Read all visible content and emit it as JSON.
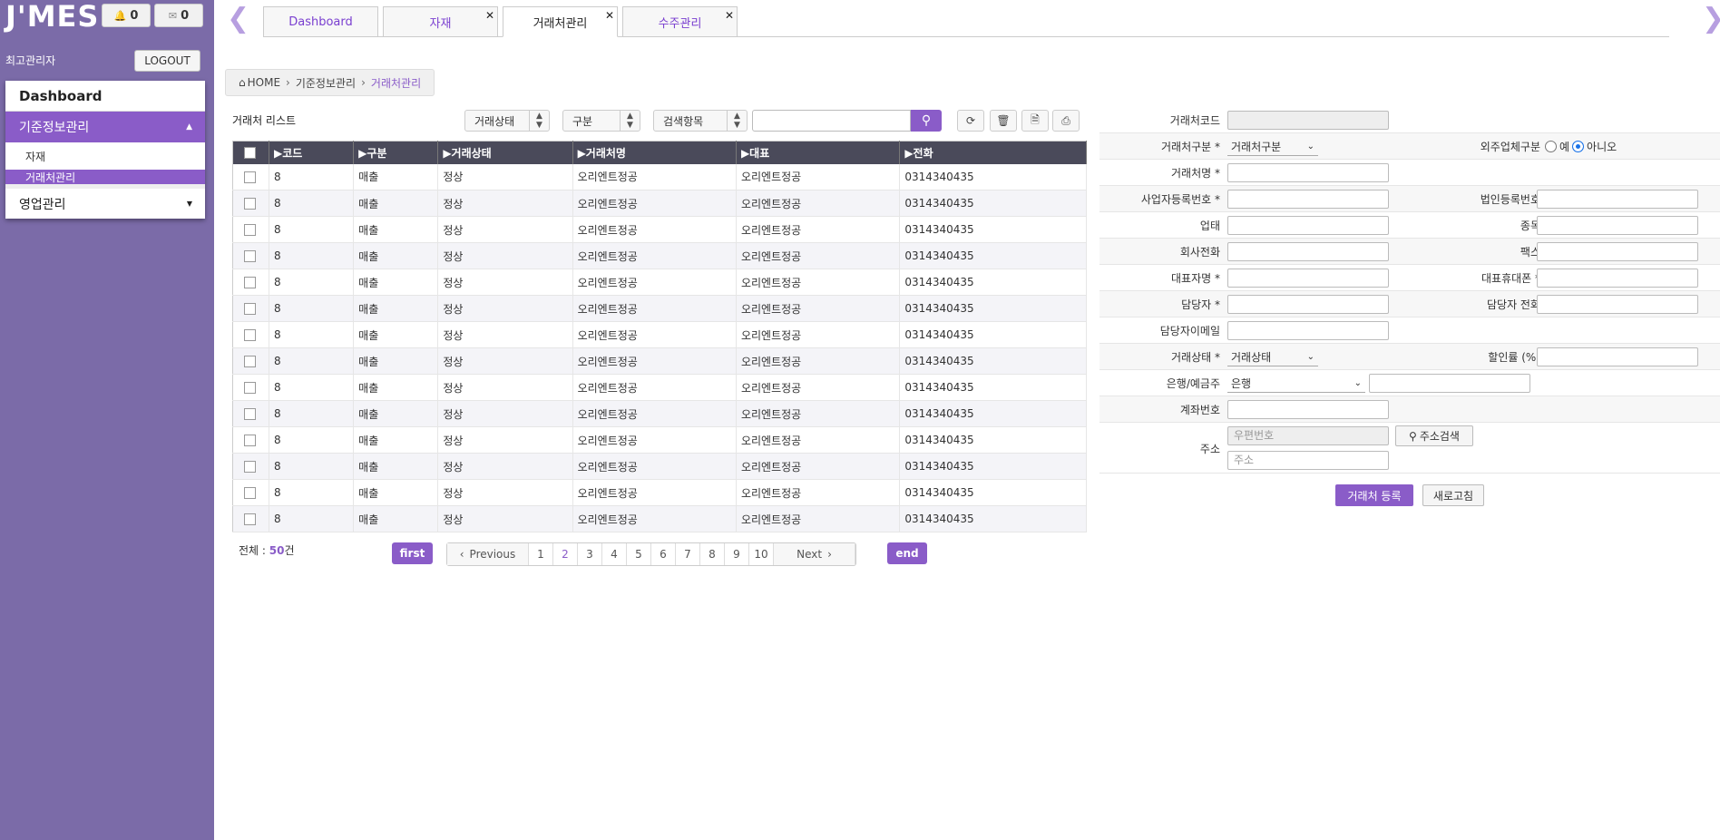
{
  "app": {
    "logo": "J'MES",
    "notifications": "0",
    "messages": "0",
    "user": "최고관리자",
    "logout_label": "LOGOUT"
  },
  "sidebar": {
    "dashboard": "Dashboard",
    "group1": {
      "label": "기준정보관리",
      "items": [
        "자재",
        "거래처관리"
      ]
    },
    "group2": {
      "label": "영업관리"
    }
  },
  "tabs": [
    {
      "label": "Dashboard",
      "closable": false
    },
    {
      "label": "자재",
      "closable": true
    },
    {
      "label": "거래처관리",
      "closable": true,
      "active": true
    },
    {
      "label": "수주관리",
      "closable": true
    }
  ],
  "breadcrumb": {
    "home": "HOME",
    "level1": "기준정보관리",
    "current": "거래처관리"
  },
  "list": {
    "title": "거래처 리스트",
    "filters": {
      "status": "거래상태",
      "type": "구분",
      "search_field": "검색항목"
    },
    "search_value": "",
    "columns": [
      "▶코드",
      "▶구분",
      "▶거래상태",
      "▶거래처명",
      "▶대표",
      "▶전화"
    ],
    "rows": [
      [
        "8",
        "매출",
        "정상",
        "오리엔트정공",
        "오리엔트정공",
        "0314340435"
      ],
      [
        "8",
        "매출",
        "정상",
        "오리엔트정공",
        "오리엔트정공",
        "0314340435"
      ],
      [
        "8",
        "매출",
        "정상",
        "오리엔트정공",
        "오리엔트정공",
        "0314340435"
      ],
      [
        "8",
        "매출",
        "정상",
        "오리엔트정공",
        "오리엔트정공",
        "0314340435"
      ],
      [
        "8",
        "매출",
        "정상",
        "오리엔트정공",
        "오리엔트정공",
        "0314340435"
      ],
      [
        "8",
        "매출",
        "정상",
        "오리엔트정공",
        "오리엔트정공",
        "0314340435"
      ],
      [
        "8",
        "매출",
        "정상",
        "오리엔트정공",
        "오리엔트정공",
        "0314340435"
      ],
      [
        "8",
        "매출",
        "정상",
        "오리엔트정공",
        "오리엔트정공",
        "0314340435"
      ],
      [
        "8",
        "매출",
        "정상",
        "오리엔트정공",
        "오리엔트정공",
        "0314340435"
      ],
      [
        "8",
        "매출",
        "정상",
        "오리엔트정공",
        "오리엔트정공",
        "0314340435"
      ],
      [
        "8",
        "매출",
        "정상",
        "오리엔트정공",
        "오리엔트정공",
        "0314340435"
      ],
      [
        "8",
        "매출",
        "정상",
        "오리엔트정공",
        "오리엔트정공",
        "0314340435"
      ],
      [
        "8",
        "매출",
        "정상",
        "오리엔트정공",
        "오리엔트정공",
        "0314340435"
      ],
      [
        "8",
        "매출",
        "정상",
        "오리엔트정공",
        "오리엔트정공",
        "0314340435"
      ]
    ],
    "total_label": "전체 : ",
    "total_count": "50",
    "total_unit": "건"
  },
  "pagination": {
    "first": "first",
    "previous": "Previous",
    "next": "Next",
    "end": "end",
    "pages": [
      "1",
      "2",
      "3",
      "4",
      "5",
      "6",
      "7",
      "8",
      "9",
      "10"
    ],
    "current": "2"
  },
  "form": {
    "code": "거래처코드",
    "type": "거래처구분 *",
    "type_value": "거래처구분",
    "outsource": "외주업체구분",
    "outsource_yes": "예",
    "outsource_no": "아니오",
    "name": "거래처명 *",
    "biz_no": "사업자등록번호 *",
    "corp_no": "법인등록번호",
    "biz_type": "업태",
    "biz_item": "종목",
    "phone": "회사전화",
    "fax": "팩스",
    "ceo": "대표자명 *",
    "ceo_mobile": "대표휴대폰 *",
    "manager": "담당자 *",
    "manager_phone": "담당자 전화",
    "manager_email": "담당자이메일",
    "status": "거래상태 *",
    "status_value": "거래상태",
    "discount": "할인률 (%)",
    "bank": "은행/예금주",
    "bank_value": "은행",
    "account": "계좌번호",
    "address": "주소",
    "zip_placeholder": "우편번호",
    "address_search": "주소검색",
    "address_placeholder": "주소",
    "register": "거래처 등록",
    "reset": "새로고침"
  },
  "colors": {
    "accent": "#8a5cc8",
    "sidebar": "#7b6ba8",
    "header": "#4a4a5a"
  }
}
